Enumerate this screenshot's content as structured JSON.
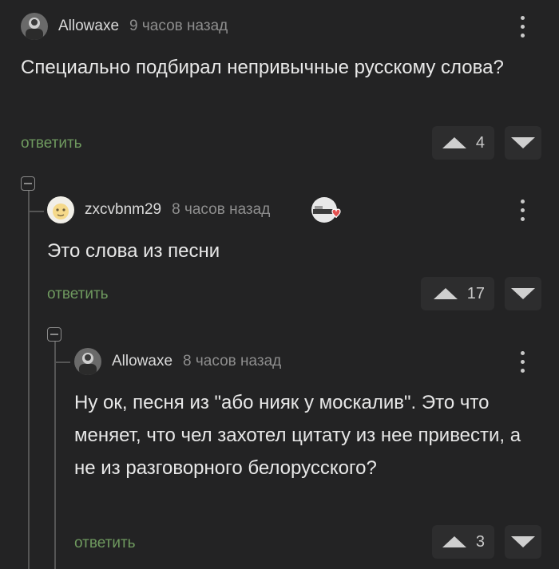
{
  "comments": [
    {
      "author": "Allowaxe",
      "time": "9 часов назад",
      "text": "Специально подбирал непривычные русскому слова?",
      "reply_label": "ответить",
      "rating": "4",
      "avatar": "dark-photo-avatar"
    },
    {
      "author": "zxcvbnm29",
      "time": "8 часов назад",
      "text": "Это слова из песни",
      "reply_label": "ответить",
      "rating": "17",
      "avatar": "light-cartoon-avatar",
      "badge": "heart-badge-icon"
    },
    {
      "author": "Allowaxe",
      "time": "8 часов назад",
      "text": "Ну ок, песня из \"або нияк у москалив\". Это что меняет, что чел захотел цитату из нее привести, а не из разговорного белорусского?",
      "reply_label": "ответить",
      "rating": "3",
      "avatar": "dark-photo-avatar"
    }
  ],
  "icons": {
    "upvote": "triangle-up-icon",
    "downvote": "triangle-down-icon",
    "menu": "kebab-menu-icon",
    "collapse": "collapse-minus-icon"
  },
  "colors": {
    "background": "#232324",
    "reply_link": "#6f9a5f",
    "text": "#e8e8e8",
    "meta": "#8e8e8e"
  }
}
